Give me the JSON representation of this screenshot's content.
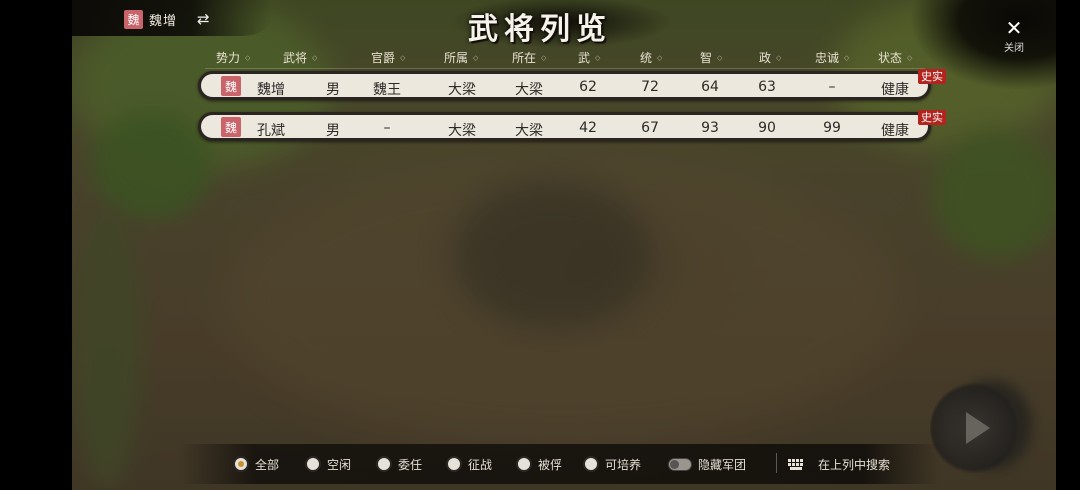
{
  "header": {
    "player_seal": "魏",
    "player_name": "魏增",
    "swap_icon": "⇄",
    "title": "武将列览",
    "close_icon": "✕",
    "close_label": "关闭"
  },
  "table": {
    "sort_arrow": "◇",
    "columns": [
      "势力",
      "武将",
      "官爵",
      "所属",
      "所在",
      "武",
      "统",
      "智",
      "政",
      "忠诚",
      "状态"
    ],
    "rows": [
      {
        "seal": "魏",
        "name": "魏增",
        "gender": "男",
        "rank": "魏王",
        "belong": "大梁",
        "location": "大梁",
        "war": "62",
        "lead": "72",
        "intel": "64",
        "politics": "63",
        "loyalty": "–",
        "status": "健康",
        "tag": "史实"
      },
      {
        "seal": "魏",
        "name": "孔斌",
        "gender": "男",
        "rank": "–",
        "belong": "大梁",
        "location": "大梁",
        "war": "42",
        "lead": "67",
        "intel": "93",
        "politics": "90",
        "loyalty": "99",
        "status": "健康",
        "tag": "史实"
      }
    ]
  },
  "filters": {
    "options": [
      "全部",
      "空闲",
      "委任",
      "征战",
      "被俘",
      "可培养"
    ],
    "selected": "全部",
    "toggle_label": "隐藏军团",
    "search_label": "在上列中搜索"
  },
  "colors": {
    "seal_red": "#c9646a",
    "tag_red": "#b3241e",
    "row_bg": "#ede8de",
    "radio_selected": "#c8922e"
  }
}
